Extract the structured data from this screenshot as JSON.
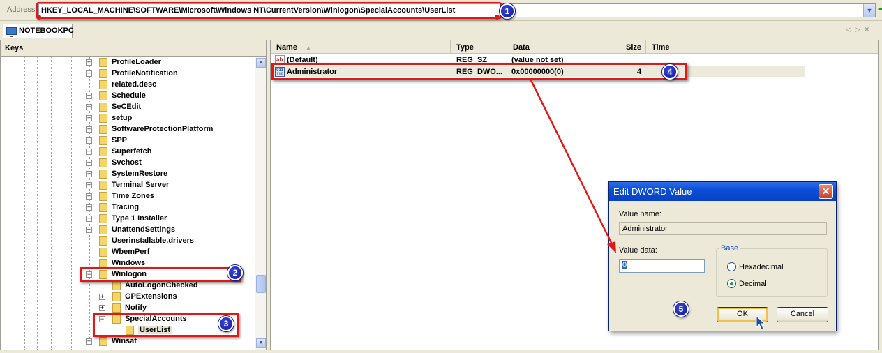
{
  "address": {
    "label": "Address",
    "path": "HKEY_LOCAL_MACHINE\\SOFTWARE\\Microsoft\\Windows NT\\CurrentVersion\\Winlogon\\SpecialAccounts\\UserList"
  },
  "tab": {
    "label": "NOTEBOOKPC"
  },
  "keys_pane": {
    "header": "Keys",
    "items": [
      "ProfileLoader",
      "ProfileNotification",
      "related.desc",
      "Schedule",
      "SeCEdit",
      "setup",
      "SoftwareProtectionPlatform",
      "SPP",
      "Superfetch",
      "Svchost",
      "SystemRestore",
      "Terminal Server",
      "Time Zones",
      "Tracing",
      "Type 1 Installer",
      "UnattendSettings",
      "Userinstallable.drivers",
      "WbemPerf",
      "Windows",
      "Winlogon",
      "AutoLogonChecked",
      "GPExtensions",
      "Notify",
      "SpecialAccounts",
      "UserList",
      "Winsat"
    ]
  },
  "values_pane": {
    "columns": {
      "name": "Name",
      "type": "Type",
      "data": "Data",
      "size": "Size",
      "time": "Time"
    },
    "rows": [
      {
        "name": "(Default)",
        "type": "REG_SZ",
        "data": "(value not set)",
        "size": ""
      },
      {
        "name": "Administrator",
        "type": "REG_DWO...",
        "data": "0x00000000(0)",
        "size": "4"
      }
    ]
  },
  "dialog": {
    "title": "Edit DWORD Value",
    "value_name_label": "Value name:",
    "value_name": "Administrator",
    "value_data_label": "Value data:",
    "value_data": "0",
    "base_label": "Base",
    "hex_label": "Hexadecimal",
    "dec_label": "Decimal",
    "ok": "OK",
    "cancel": "Cancel",
    "close_glyph": "✕"
  },
  "badges": [
    "1",
    "2",
    "3",
    "4",
    "5"
  ],
  "colors": {
    "callout_red": "#e01818",
    "badge_blue": "#0e1799",
    "title_blue": "#0a4fd8"
  }
}
